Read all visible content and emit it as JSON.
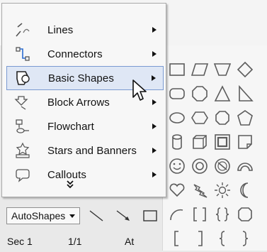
{
  "menu": {
    "items": [
      {
        "label": "Lines",
        "icon": "lines-icon"
      },
      {
        "label": "Connectors",
        "icon": "connectors-icon"
      },
      {
        "label": "Basic Shapes",
        "icon": "basic-shapes-icon",
        "active": true
      },
      {
        "label": "Block Arrows",
        "icon": "block-arrows-icon"
      },
      {
        "label": "Flowchart",
        "icon": "flowchart-icon"
      },
      {
        "label": "Stars and Banners",
        "icon": "stars-banners-icon"
      },
      {
        "label": "Callouts",
        "icon": "callouts-icon"
      }
    ],
    "more_icon": "double-chevron-down-icon"
  },
  "toolbar": {
    "autoshapes_label": "AutoShapes",
    "tools": [
      "line-tool-icon",
      "arrow-tool-icon",
      "rectangle-tool-icon"
    ]
  },
  "status": {
    "section": "Sec 1",
    "page": "1/1",
    "at": "At"
  },
  "colors": {
    "menu_bg": "#f7f7f7",
    "active_bg": "#dfe7f5",
    "active_border": "#7a9ad1",
    "palette_stroke": "#5c5c5c"
  }
}
